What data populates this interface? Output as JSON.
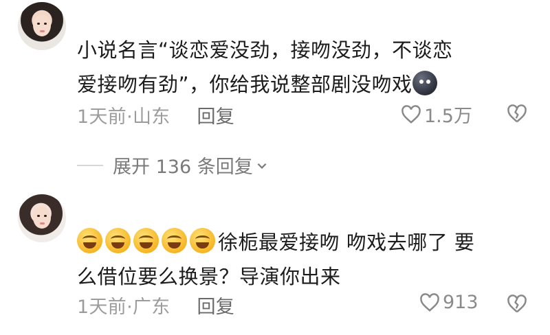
{
  "comments": [
    {
      "text_line1": "小说名言“谈恋爱没劲，接吻没劲，不谈恋",
      "text_line2": "爱接吻有劲”，你给我说整部剧没吻戏",
      "time": "1天前",
      "location": "山东",
      "reply_label": "回复",
      "likes": "1.5万",
      "expand_label": "展开 136 条回复"
    },
    {
      "text_line1": "徐栀最爱接吻 吻戏去哪了 要",
      "text_line2": "么借位要么换景？导演你出来",
      "time": "1天前",
      "location": "广东",
      "reply_label": "回复",
      "likes": "913"
    }
  ],
  "separator": "·"
}
